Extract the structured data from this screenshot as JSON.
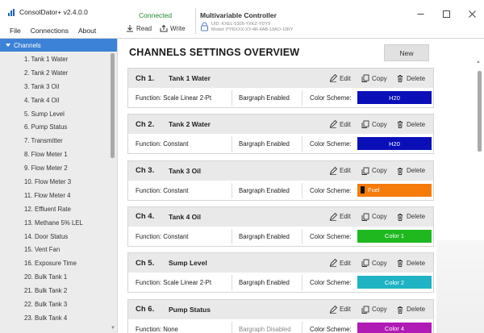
{
  "app": {
    "title": "ConsolDator+ v2.4.0.0",
    "menu": [
      "File",
      "Connections",
      "About"
    ]
  },
  "toolbar": {
    "status": "Connected",
    "read_label": "Read",
    "write_label": "Write",
    "controller_title": "Multivariable Controller",
    "controller_uid": "UID: KXEL-5305-YXKZ-YDY9",
    "controller_model": "Model: PYRXXX-XY-4R-4AB-10AO-10RY"
  },
  "window_controls": [
    "minimize-icon",
    "maximize-icon",
    "close-icon"
  ],
  "sidebar": {
    "header": "Channels",
    "items": [
      "1. Tank 1 Water",
      "2. Tank 2 Water",
      "3. Tank 3 Oil",
      "4. Tank 4 Oil",
      "5. Sump Level",
      "6. Pump Status",
      "7. Transmitter",
      "8. Flow Meter 1",
      "9. Flow Meter 2",
      "10. Flow Meter 3",
      "11. Flow Meter 4",
      "12. Effluent Rate",
      "13. Methane 5% LEL",
      "14. Door Status",
      "15. Vent Fan",
      "16. Exposure Time",
      "20. Bulk Tank 1",
      "21. Bulk Tank 2",
      "22. Bulk Tank 3",
      "23. Bulk Tank 4"
    ]
  },
  "main": {
    "title": "CHANNELS SETTINGS OVERVIEW",
    "new_button": "New",
    "actions": {
      "edit": "Edit",
      "copy": "Copy",
      "delete": "Delete"
    },
    "function_label": "Function:",
    "color_label": "Color Scheme:",
    "channels": [
      {
        "num": "Ch 1.",
        "name": "Tank 1 Water",
        "function": "Function: Scale Linear 2-Pt",
        "bargraph": "Bargraph Enabled",
        "bargraph_disabled": false,
        "color_name": "H20",
        "color": "#0a0fb8",
        "mark": false
      },
      {
        "num": "Ch 2.",
        "name": "Tank 2 Water",
        "function": "Function: Constant",
        "bargraph": "Bargraph Enabled",
        "bargraph_disabled": false,
        "color_name": "H20",
        "color": "#0a0fb8",
        "mark": false
      },
      {
        "num": "Ch 3.",
        "name": "Tank 3 Oil",
        "function": "Function: Constant",
        "bargraph": "Bargraph Enabled",
        "bargraph_disabled": false,
        "color_name": "Fuel",
        "color": "#f57c0a",
        "mark": true
      },
      {
        "num": "Ch 4.",
        "name": "Tank 4 Oil",
        "function": "Function: Constant",
        "bargraph": "Bargraph Enabled",
        "bargraph_disabled": false,
        "color_name": "Color 1",
        "color": "#1fb81f",
        "mark": false
      },
      {
        "num": "Ch 5.",
        "name": "Sump Level",
        "function": "Function: Scale Linear 2-Pt",
        "bargraph": "Bargraph Enabled",
        "bargraph_disabled": false,
        "color_name": "Color 2",
        "color": "#1fb3c4",
        "mark": false
      },
      {
        "num": "Ch 6.",
        "name": "Pump Status",
        "function": "Function: None",
        "bargraph": "Bargraph Disabled",
        "bargraph_disabled": true,
        "color_name": "Color 4",
        "color": "#b01ab5",
        "mark": false
      }
    ]
  }
}
